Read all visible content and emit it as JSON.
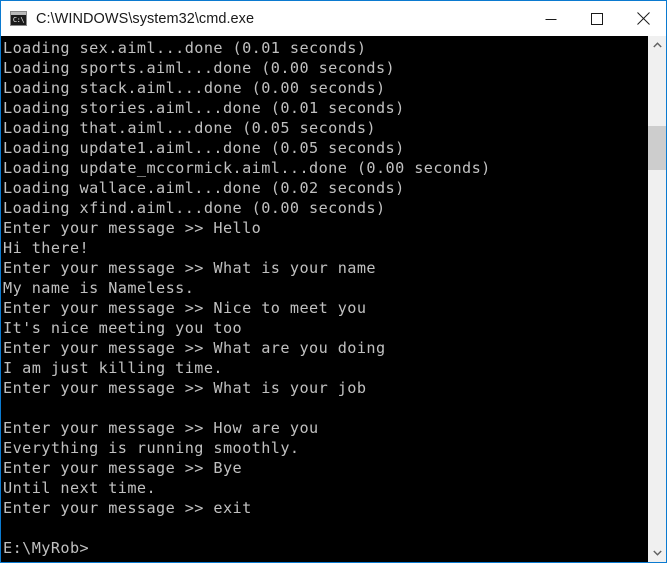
{
  "window": {
    "title": "C:\\WINDOWS\\system32\\cmd.exe",
    "icon_name": "cmd-exe-icon",
    "icon_glyph": "C:\\",
    "border_color": "#0b7ad0",
    "titlebar_background": "#ffffff",
    "title_color": "#1a1a1a",
    "controls": {
      "minimize_label": "Minimize",
      "maximize_label": "Maximize",
      "close_label": "Close"
    }
  },
  "console": {
    "background_color": "#000000",
    "text_color": "#c0c0c0",
    "prompt_symbol": ">>",
    "current_directory_prompt": "E:\\MyRob>",
    "lines": [
      "Loading sex.aiml...done (0.01 seconds)",
      "Loading sports.aiml...done (0.00 seconds)",
      "Loading stack.aiml...done (0.00 seconds)",
      "Loading stories.aiml...done (0.01 seconds)",
      "Loading that.aiml...done (0.05 seconds)",
      "Loading update1.aiml...done (0.05 seconds)",
      "Loading update_mccormick.aiml...done (0.00 seconds)",
      "Loading wallace.aiml...done (0.02 seconds)",
      "Loading xfind.aiml...done (0.00 seconds)",
      "Enter your message >> Hello",
      "Hi there!",
      "Enter your message >> What is your name",
      "My name is Nameless.",
      "Enter your message >> Nice to meet you",
      "It's nice meeting you too",
      "Enter your message >> What are you doing",
      "I am just killing time.",
      "Enter your message >> What is your job",
      "",
      "Enter your message >> How are you",
      "Everything is running smoothly.",
      "Enter your message >> Bye",
      "Until next time.",
      "Enter your message >> exit",
      "",
      "E:\\MyRob>"
    ]
  },
  "scrollbar": {
    "up_arrow_name": "scroll-up-arrow",
    "down_arrow_name": "scroll-down-arrow",
    "track_color": "#f0f0f0",
    "thumb_color": "#cdcdcd"
  }
}
